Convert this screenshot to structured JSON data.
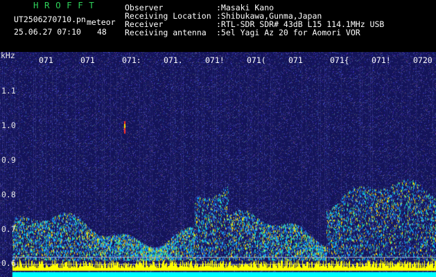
{
  "header": {
    "title": "H R O F F T",
    "filename": "UT2506270710.pn",
    "meteor_label": "meteor",
    "timestamp": "25.06.27 07:10",
    "meteor_count": "48",
    "fields": [
      {
        "label": "Observer",
        "value": ":Masaki Kano"
      },
      {
        "label": "Receiving Location",
        "value": ":Shibukawa,Gunma,Japan"
      },
      {
        "label": "Receiver",
        "value": ":RTL-SDR SDR# 43dB L15 114.1MHz USB"
      },
      {
        "label": "Receiving antenna",
        "value": ":5el Yagi Az 20 for Aomori VOR"
      }
    ]
  },
  "spectrogram": {
    "unit_label": "kHz",
    "time_labels": [
      "071",
      "071",
      "071:",
      "071.",
      "071!",
      "071(",
      "071",
      "071{",
      "071!",
      "0720"
    ],
    "freq_labels": [
      "1.1",
      "1.0",
      "0.9",
      "0.8",
      "0.7",
      "0.6"
    ],
    "colors": {
      "background": "#14145a",
      "noise": "#3a3aa0",
      "signal_cyan": "#00d0ff",
      "signal_green": "#40e080",
      "signal_yellow": "#ffe000",
      "meteor_red": "#ff3020",
      "baseline_yellow": "#ffff00",
      "baseline_cyan": "#00ffff",
      "time_label": "#ffffff"
    }
  }
}
